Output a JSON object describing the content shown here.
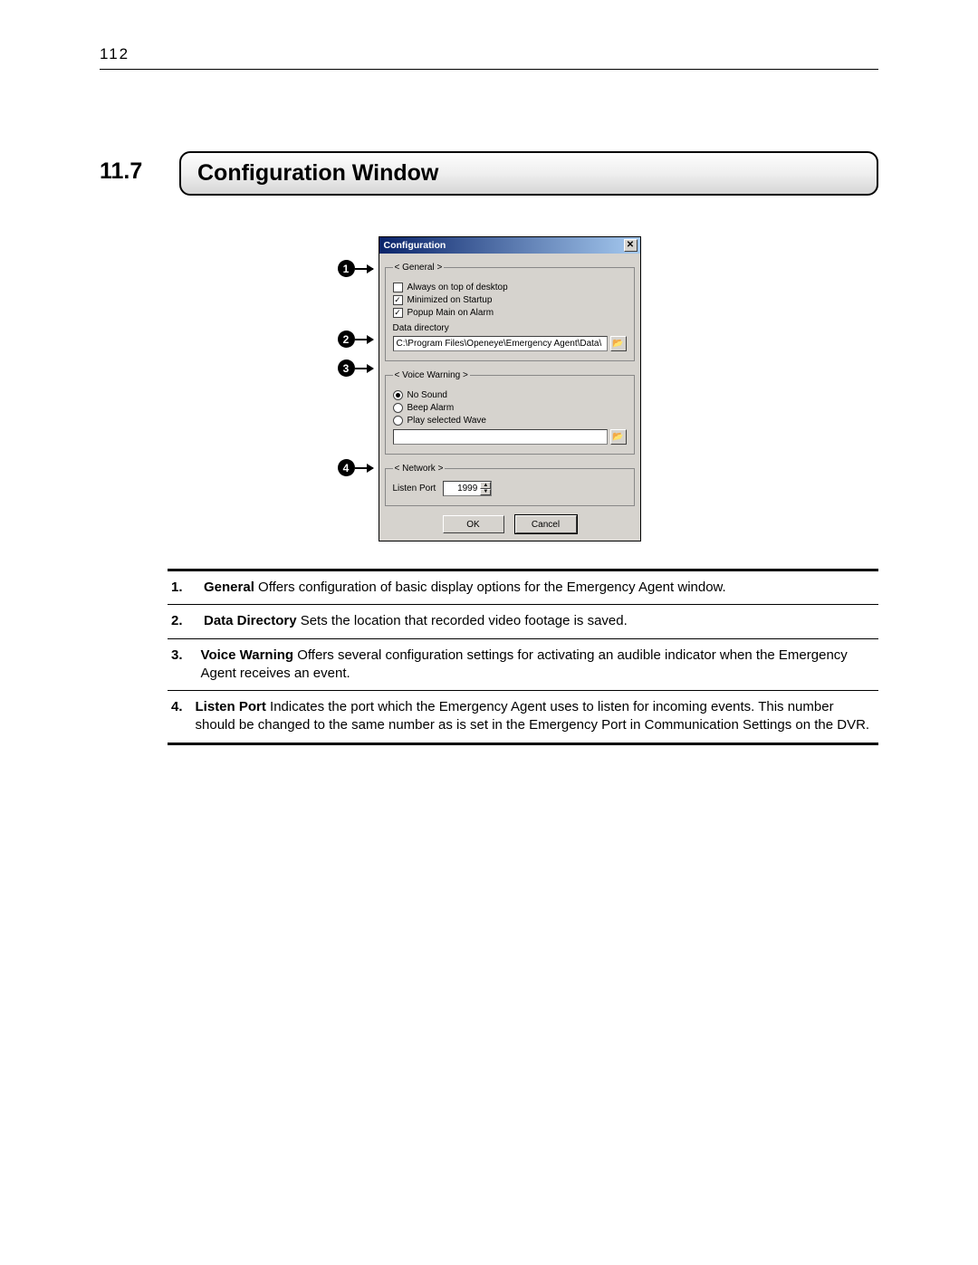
{
  "page_number": "112",
  "section_number": "11.7",
  "section_title": "Configuration Window",
  "dialog": {
    "title": "Configuration",
    "close_glyph": "✕",
    "general": {
      "legend": "< General >",
      "opt_always_on_top": "Always on top of desktop",
      "opt_minimized": "Minimized on Startup",
      "opt_popup": "Popup Main on Alarm",
      "data_dir_label": "Data directory",
      "data_dir_value": "C:\\Program Files\\Openeye\\Emergency Agent\\Data\\",
      "browse_glyph": "📂"
    },
    "voice": {
      "legend": "< Voice Warning >",
      "opt_no_sound": "No Sound",
      "opt_beep": "Beep Alarm",
      "opt_wave": "Play selected Wave",
      "wave_path": "",
      "browse_glyph": "📂"
    },
    "network": {
      "legend": "< Network >",
      "listen_port_label": "Listen Port",
      "listen_port_value": "1999"
    },
    "ok_label": "OK",
    "cancel_label": "Cancel"
  },
  "callouts": {
    "c1": "1",
    "c2": "2",
    "c3": "3",
    "c4": "4"
  },
  "descriptions": [
    {
      "num": "1.",
      "bold": "General",
      "text": " Offers configuration of basic display options for the Emergency Agent window."
    },
    {
      "num": "2.",
      "bold": "Data Directory",
      "text": " Sets the location that recorded video footage is saved."
    },
    {
      "num": "3.",
      "bold": "Voice Warning",
      "text": " Offers several configuration settings for activating an audible indicator when the Emergency Agent receives an event."
    },
    {
      "num": "4.",
      "bold": "Listen Port",
      "text": " Indicates the port which the Emergency Agent uses to listen for incoming events. This number should be changed to the same number as is set in the Emergency Port in Communication Settings on the DVR."
    }
  ]
}
